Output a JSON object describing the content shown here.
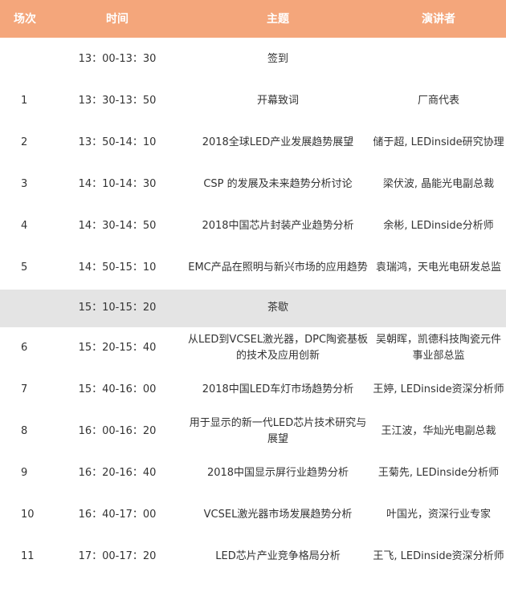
{
  "header": {
    "col_session": "场次",
    "col_time": "时间",
    "col_topic": "主题",
    "col_speaker": "演讲者"
  },
  "rows": [
    {
      "session": "",
      "time": "13：00-13：30",
      "topic": "签到",
      "speaker": ""
    },
    {
      "session": "1",
      "time": "13：30-13：50",
      "topic": "开幕致词",
      "speaker": "厂商代表"
    },
    {
      "session": "2",
      "time": "13：50-14：10",
      "topic": "2018全球LED产业发展趋势展望",
      "speaker": "储于超, LEDinside研究协理"
    },
    {
      "session": "3",
      "time": "14：10-14：30",
      "topic": "CSP 的发展及未来趋势分析讨论",
      "speaker": "梁伏波, 晶能光电副总裁"
    },
    {
      "session": "4",
      "time": "14：30-14：50",
      "topic": "2018中国芯片封装产业趋势分析",
      "speaker": "余彬, LEDinside分析师"
    },
    {
      "session": "5",
      "time": "14：50-15：10",
      "topic": "EMC产品在照明与新兴市场的应用趋势",
      "speaker": "袁瑞鸿，天电光电研发总监"
    },
    {
      "session": "",
      "time": "15：10-15：20",
      "topic": "茶歇",
      "speaker": ""
    },
    {
      "session": "6",
      "time": "15：20-15：40",
      "topic": "从LED到VCSEL激光器，DPC陶瓷基板的技术及应用创新",
      "speaker": "吴朝晖，凯德科技陶瓷元件事业部总监"
    },
    {
      "session": "7",
      "time": "15：40-16：00",
      "topic": "2018中国LED车灯市场趋势分析",
      "speaker": "王婷, LEDinside资深分析师"
    },
    {
      "session": "8",
      "time": "16：00-16：20",
      "topic": "用于显示的新一代LED芯片技术研究与展望",
      "speaker": "王江波，华灿光电副总裁"
    },
    {
      "session": "9",
      "time": "16：20-16：40",
      "topic": "2018中国显示屏行业趋势分析",
      "speaker": "王菊先, LEDinside分析师"
    },
    {
      "session": "10",
      "time": "16：40-17：00",
      "topic": "VCSEL激光器市场发展趋势分析",
      "speaker": "叶国光，资深行业专家"
    },
    {
      "session": "11",
      "time": "17：00-17：20",
      "topic": "LED芯片产业竞争格局分析",
      "speaker": "王飞, LEDinside资深分析师"
    }
  ],
  "colors": {
    "header_bg": "#f4a67b",
    "header_text": "#ffffff",
    "break_row_bg": "#e4e4e4",
    "body_text": "#333333"
  }
}
